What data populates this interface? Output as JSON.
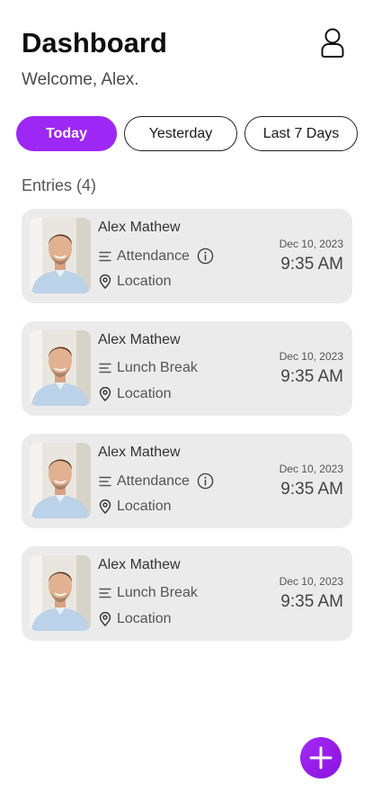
{
  "header": {
    "title": "Dashboard",
    "welcome": "Welcome, Alex."
  },
  "filters": [
    {
      "label": "Today",
      "active": true
    },
    {
      "label": "Yesterday",
      "active": false
    },
    {
      "label": "Last 7 Days",
      "active": false
    }
  ],
  "entries": {
    "label": "Entries (4)",
    "items": [
      {
        "name": "Alex Mathew",
        "type": "Attendance",
        "has_info": true,
        "location": "Location",
        "date": "Dec 10, 2023",
        "time": "9:35 AM"
      },
      {
        "name": "Alex Mathew",
        "type": "Lunch Break",
        "has_info": false,
        "location": "Location",
        "date": "Dec 10, 2023",
        "time": "9:35 AM"
      },
      {
        "name": "Alex Mathew",
        "type": "Attendance",
        "has_info": true,
        "location": "Location",
        "date": "Dec 10, 2023",
        "time": "9:35 AM"
      },
      {
        "name": "Alex Mathew",
        "type": "Lunch Break",
        "has_info": false,
        "location": "Location",
        "date": "Dec 10, 2023",
        "time": "9:35 AM"
      }
    ]
  },
  "icons": {
    "profile": "user-icon",
    "type": "list-lines-icon",
    "info": "info-icon",
    "location": "location-pin-icon",
    "add": "plus-icon"
  },
  "colors": {
    "accent": "#9d27f5",
    "card": "#ebebeb"
  }
}
